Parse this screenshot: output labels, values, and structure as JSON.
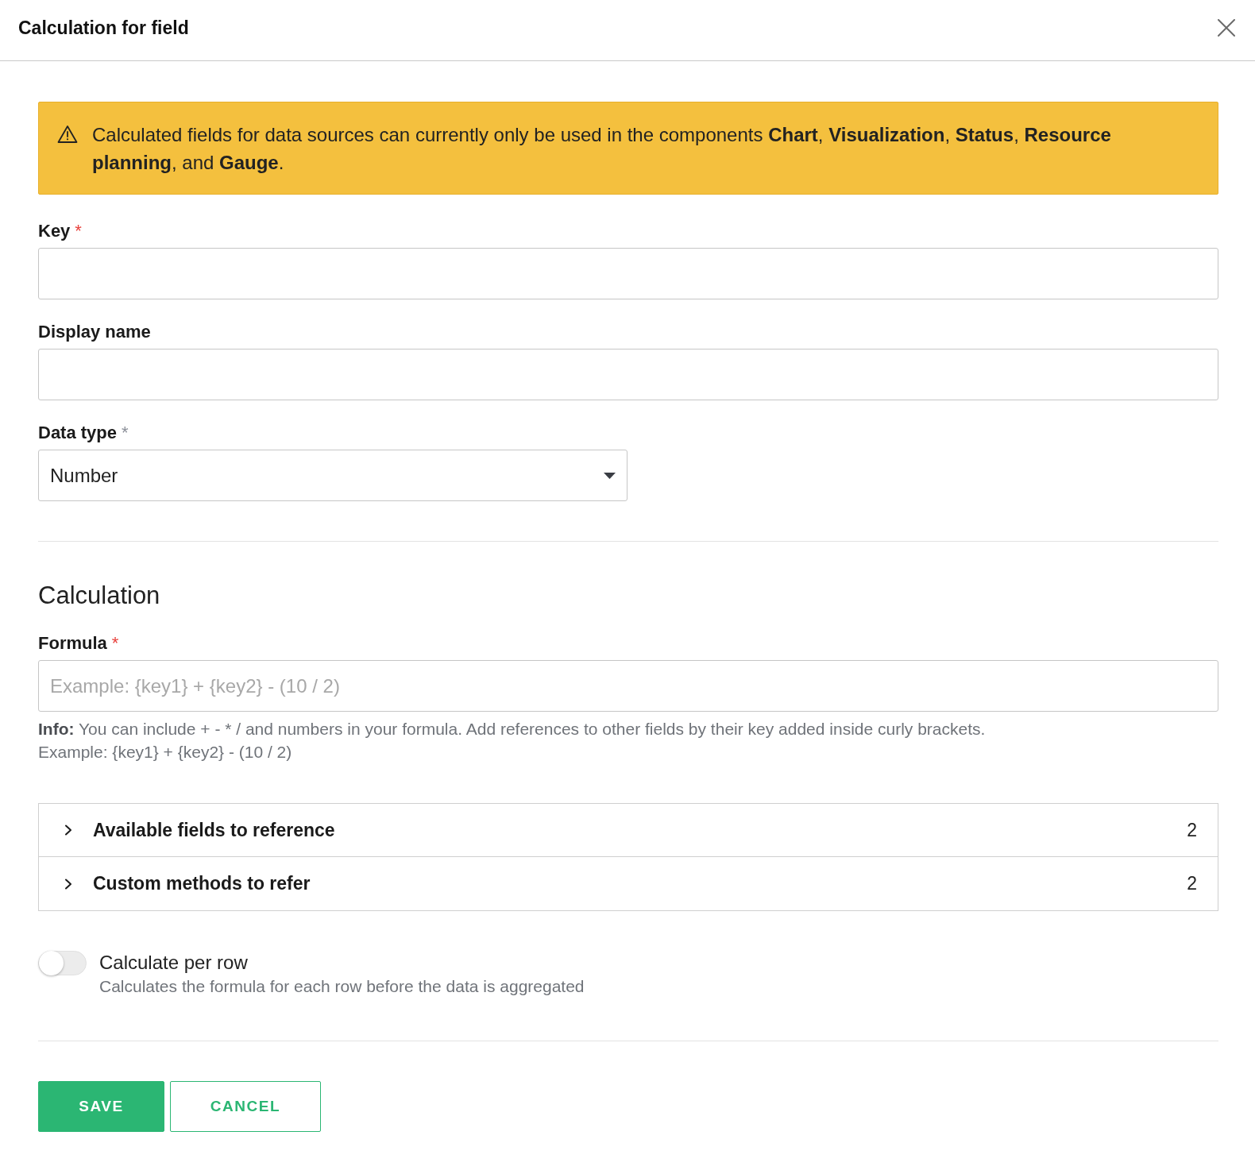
{
  "dialog": {
    "title": "Calculation for field"
  },
  "alert": {
    "text": "Calculated fields for data sources can currently only be used in the components **Chart**, **Visualization**, **Status**, **Resource planning**, and **Gauge**."
  },
  "fields": [
    {
      "kind": "text",
      "label": "Key",
      "required_mark": {
        "text": "*",
        "color": "#e8413c"
      }
    },
    {
      "kind": "text",
      "label": "Display name"
    },
    {
      "kind": "select",
      "label": "Data type",
      "required_mark": {
        "text": "*",
        "color": "#8c9099"
      },
      "value": "Number"
    }
  ],
  "calculation": {
    "heading": "Calculation",
    "formula": {
      "label": "Formula",
      "required_mark": {
        "text": "*",
        "color": "#e8413c"
      },
      "placeholder": "Example: {key1} + {key2} - (10 / 2)"
    },
    "info": "**Info:** You can include + - * / and numbers in your formula. Add references to other fields by their key added inside curly brackets.",
    "example": "Example: {key1} + {key2} - (10 / 2)",
    "sections": [
      {
        "title": "Available fields to reference",
        "count": "2",
        "expanded": false
      },
      {
        "title": "Custom methods to refer",
        "count": "2",
        "expanded": false
      }
    ],
    "per_row": {
      "label": "Calculate per row",
      "description": "Calculates the formula for each row before the data is aggregated",
      "on": false
    }
  },
  "buttons": [
    {
      "kind": "primary",
      "label": "SAVE"
    },
    {
      "kind": "secondary",
      "label": "CANCEL"
    }
  ]
}
